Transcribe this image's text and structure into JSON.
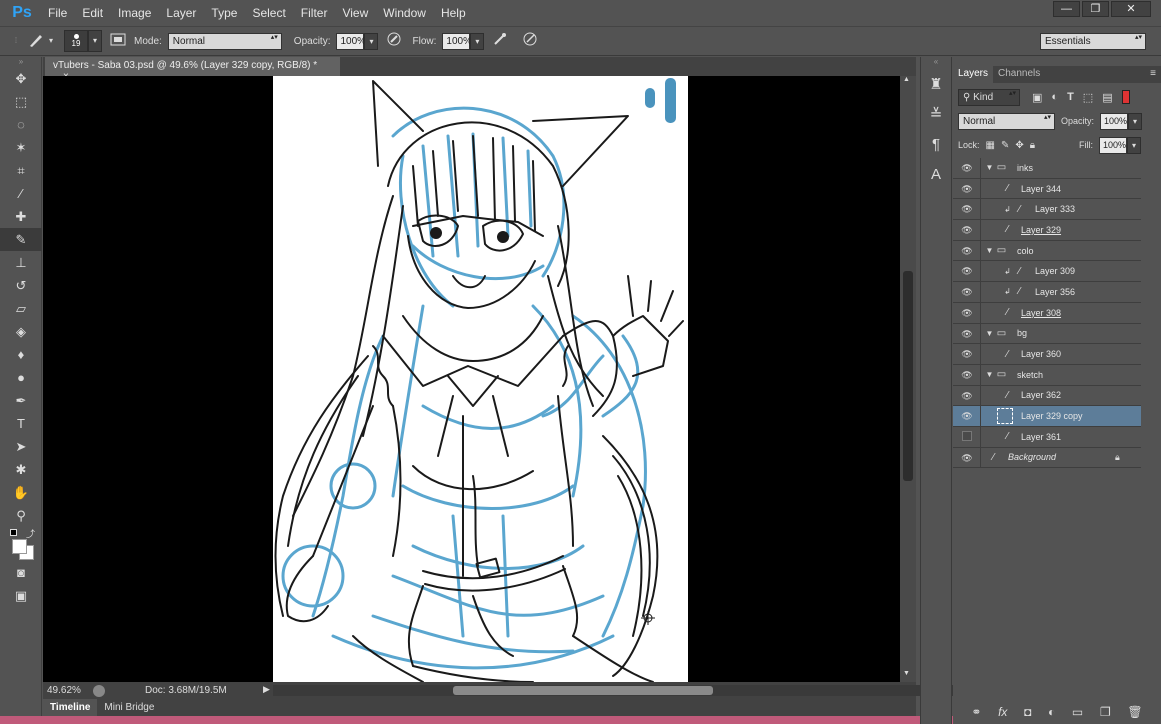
{
  "app": {
    "logo": "Ps",
    "menu": [
      "File",
      "Edit",
      "Image",
      "Layer",
      "Type",
      "Select",
      "Filter",
      "View",
      "Window",
      "Help"
    ],
    "window_controls": [
      "—",
      "❐",
      "✕"
    ]
  },
  "options": {
    "brush_size": "19",
    "mode_label": "Mode:",
    "mode_value": "Normal",
    "opacity_label": "Opacity:",
    "opacity_value": "100%",
    "flow_label": "Flow:",
    "flow_value": "100%",
    "workspace": "Essentials"
  },
  "document": {
    "tab_title": "vTubers - Saba 03.psd @ 49.6% (Layer 329 copy, RGB/8) *",
    "tab_close": "×"
  },
  "status": {
    "zoom": "49.62%",
    "doc_info": "Doc: 3.68M/19.5M"
  },
  "bottom_tabs": [
    "Timeline",
    "Mini Bridge"
  ],
  "panel": {
    "tabs": [
      "Layers",
      "Channels"
    ],
    "filter_kind": "Kind",
    "blend_mode": "Normal",
    "opacity_label": "Opacity:",
    "opacity_value": "100%",
    "lock_label": "Lock:",
    "fill_label": "Fill:",
    "fill_value": "100%",
    "layers": [
      {
        "name": "inks",
        "group": true
      },
      {
        "name": "Layer 344"
      },
      {
        "name": "Layer 333",
        "clip": true
      },
      {
        "name": "Layer 329",
        "underline": true
      },
      {
        "name": "colo",
        "group": true
      },
      {
        "name": "Layer 309",
        "clip": true
      },
      {
        "name": "Layer 356",
        "clip": true
      },
      {
        "name": "Layer 308",
        "underline": true
      },
      {
        "name": "bg",
        "group": true
      },
      {
        "name": "Layer 360"
      },
      {
        "name": "sketch",
        "group": true
      },
      {
        "name": "Layer 362"
      },
      {
        "name": "Layer 329 copy",
        "selected": true
      },
      {
        "name": "Layer 361",
        "hidden": true
      },
      {
        "name": "Background",
        "italic": true,
        "locked": true
      }
    ]
  },
  "colors": {
    "ui_bg": "#535353",
    "dark": "#424242",
    "selection": "#5d7d99",
    "sketch_blue": "#5aa6cf",
    "ink": "#1a1a1a"
  }
}
